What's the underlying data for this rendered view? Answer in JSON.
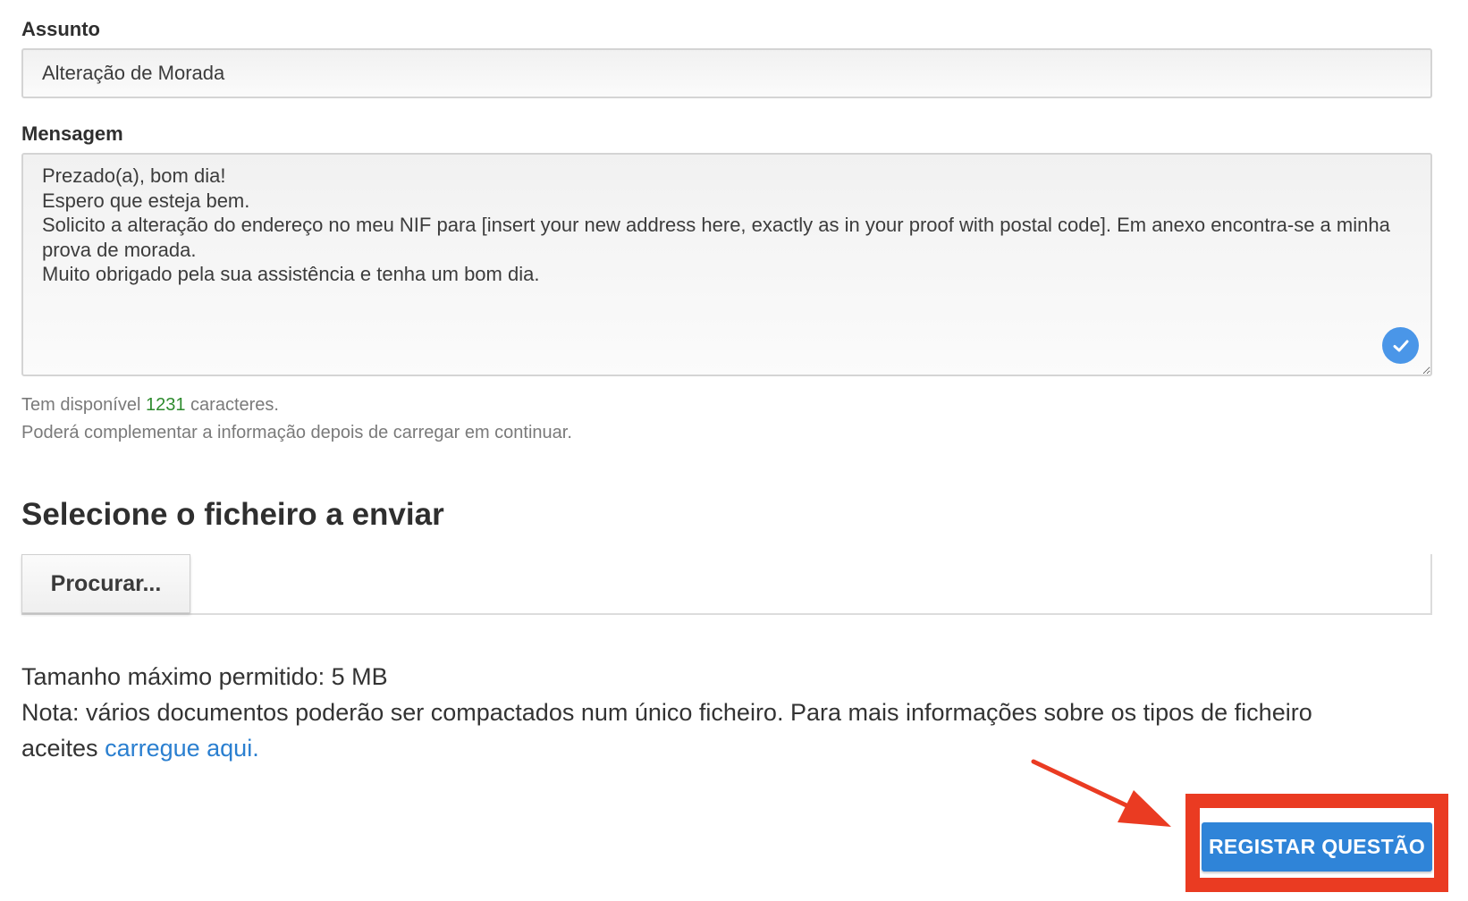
{
  "subject": {
    "label": "Assunto",
    "value": "Alteração de Morada"
  },
  "message": {
    "label": "Mensagem",
    "value": "Prezado(a), bom dia!\nEspero que esteja bem.\nSolicito a alteração do endereço no meu NIF para [insert your new address here, exactly as in your proof with postal code]. Em anexo encontra-se a minha prova de morada.\nMuito obrigado pela sua assistência e tenha um bom dia.",
    "status_icon": "check-circle-icon"
  },
  "helper": {
    "chars_prefix": "Tem disponível",
    "chars_count": "1231",
    "chars_suffix": "caracteres.",
    "continue_note": "Poderá complementar a informação depois de carregar em continuar."
  },
  "upload": {
    "title": "Selecione o ficheiro a enviar",
    "browse_label": "Procurar...",
    "max_size": "Tamanho máximo permitido: 5 MB",
    "note_line1": "Nota: vários documentos poderão ser compactados num único ficheiro. Para mais informações sobre os tipos de ficheiro",
    "note_line2_prefix": "aceites",
    "note_link": "carregue aqui."
  },
  "submit": {
    "label": "REGISTAR QUESTÃO"
  },
  "annotation": {
    "color": "#ea3b22"
  },
  "colors": {
    "accent": "#2f84d8",
    "counter_green": "#2e8b2e",
    "link_blue": "#2a7fd0"
  }
}
